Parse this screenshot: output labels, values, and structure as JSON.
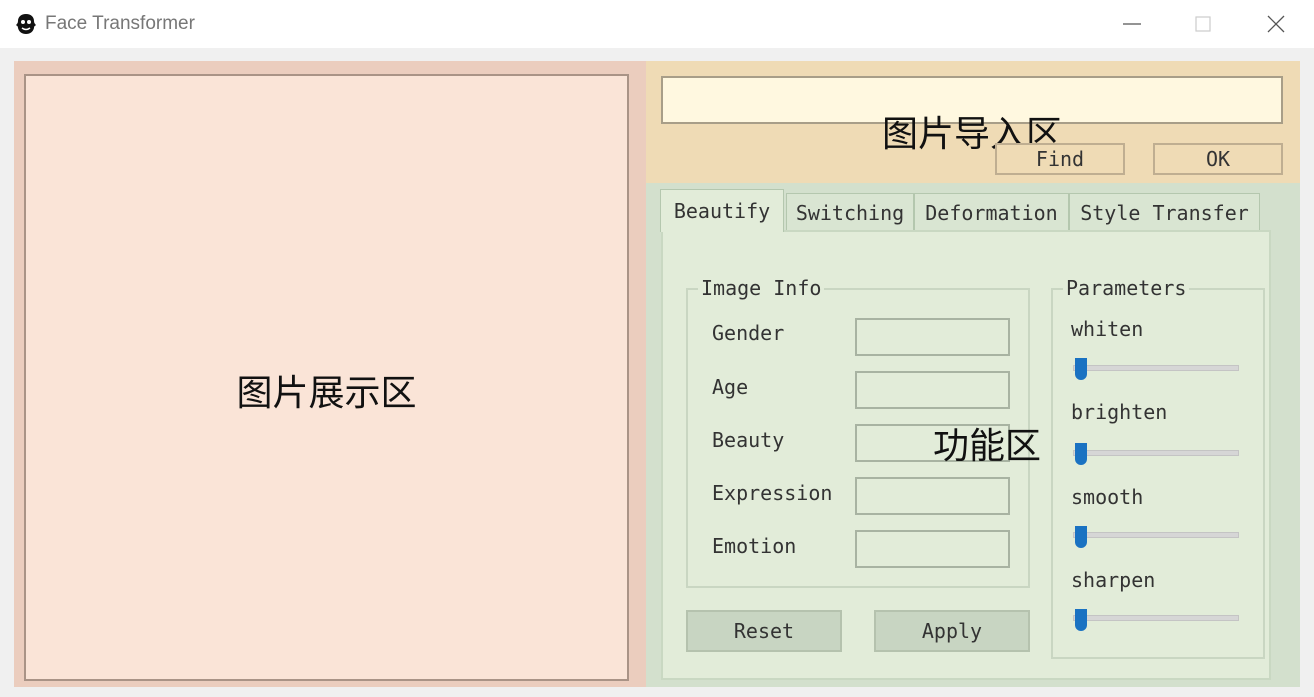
{
  "window": {
    "title": "Face Transformer",
    "icon": "face-mask-icon",
    "controls": [
      "minimize-icon",
      "maximize-icon",
      "close-icon"
    ]
  },
  "display": {
    "label": "图片展示区"
  },
  "import": {
    "label": "图片导入区",
    "path_value": "",
    "find_label": "Find",
    "ok_label": "OK"
  },
  "function_area": {
    "label": "功能区",
    "tabs": [
      "Beautify",
      "Switching",
      "Deformation",
      "Style Transfer"
    ],
    "active_tab": "Beautify",
    "image_info": {
      "title": "Image Info",
      "fields": [
        {
          "label": "Gender",
          "value": ""
        },
        {
          "label": "Age",
          "value": ""
        },
        {
          "label": "Beauty",
          "value": ""
        },
        {
          "label": "Expression",
          "value": ""
        },
        {
          "label": "Emotion",
          "value": ""
        }
      ]
    },
    "parameters": {
      "title": "Parameters",
      "sliders": [
        {
          "label": "whiten",
          "value": 0
        },
        {
          "label": "brighten",
          "value": 0
        },
        {
          "label": "smooth",
          "value": 0
        },
        {
          "label": "sharpen",
          "value": 0
        }
      ]
    },
    "reset_label": "Reset",
    "apply_label": "Apply"
  },
  "colors": {
    "display_bg": "#fae4d7",
    "import_bg": "#efdbb5",
    "function_bg": "#d3e0cd",
    "slider_handle": "#1a72c2"
  }
}
